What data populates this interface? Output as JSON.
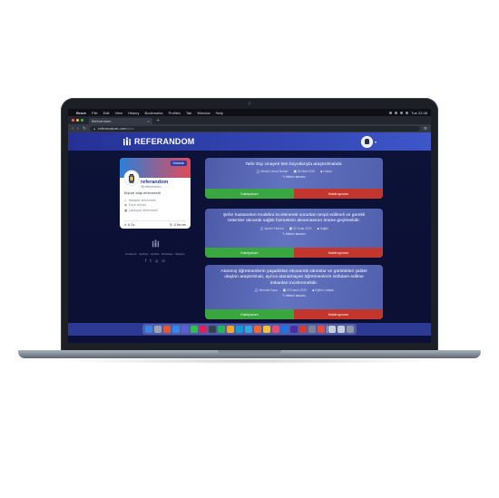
{
  "menubar": {
    "app": "Brave",
    "items": [
      "File",
      "Edit",
      "View",
      "History",
      "Bookmarks",
      "Profiles",
      "Tab",
      "Window",
      "Help"
    ],
    "clock": "Tue 22:38"
  },
  "browser": {
    "tab_title": "Referandom",
    "url_host": "referandom.com",
    "url_path": "/oov"
  },
  "site": {
    "brand": "REFERANDOM"
  },
  "profile": {
    "button": "Düzenle",
    "name": "referandom",
    "username": "@referandom",
    "title": "Kişisel bilgi eklenmedi",
    "info": [
      "Website eklenmedi",
      "Kayıt olundu",
      "Lokasyon eklenmedi"
    ],
    "likes": "0 Oy",
    "comments": "0 Yorum"
  },
  "sidebar_footer": {
    "links": "Kullanım Şartları  Gizlilik Politikası  İletişim",
    "social": [
      "f",
      "t",
      "◎",
      "in"
    ]
  },
  "cards": [
    {
      "text": "Tahir Elçi cinayeti tüm boyutlarıyla araştırılmalıdır.",
      "author": "Mesut Cemal Berber",
      "date": "25 Mart 2019",
      "category": "Hukuk",
      "vote": "Metnin tamamı",
      "yes": "Katılıyorum",
      "no": "Katılmıyorum"
    },
    {
      "text": "Şehir hastaneleri modelini incelenerek sorunları tespit edilmeli ve gerekli önlemler alınarak sağlık hizmetinin aksamasının önüne geçilmelidir.",
      "author": "Ayhan Yıldırım",
      "date": "22 Ocak 2019",
      "category": "Sağlık",
      "vote": "Metnin tamamı",
      "yes": "Katılıyorum",
      "no": "Katılmıyorum"
    },
    {
      "text": "Atanmış öğretmenlerin yaşadıkları ekonomik sıkıntılar ve görülükleri şiddet olayları araştırılmalı, ayrıca atanamayan öğretmenlerin istihdam edilme imkanları incelenmelidir.",
      "author": "Mehmet Kaya",
      "date": "22 Kasım 2019",
      "category": "Eğitim, İstişak",
      "vote": "Metnin tamamı",
      "yes": "Katılıyorum",
      "no": "Katılmıyorum"
    }
  ],
  "colors": {
    "navbar": "#2f42b0",
    "agree": "#39a63f",
    "disagree": "#c2362d",
    "background": "#0b0f3a"
  }
}
